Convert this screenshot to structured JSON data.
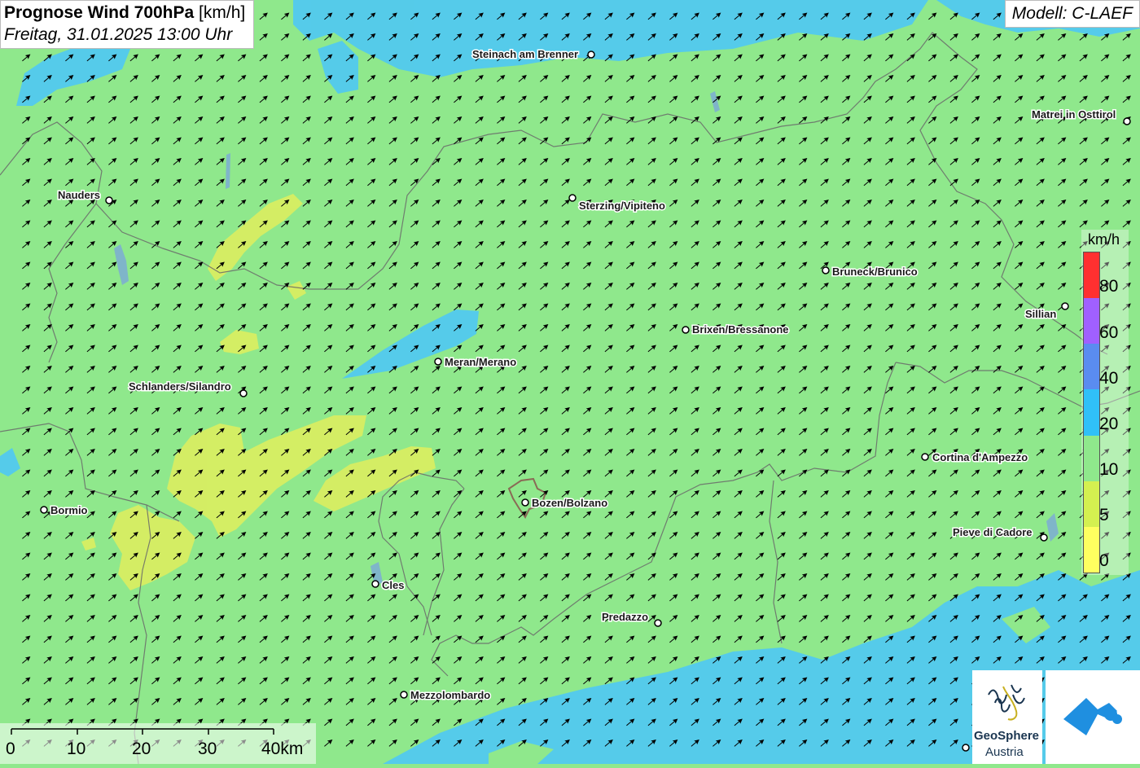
{
  "title": {
    "main": "Prognose Wind 700hPa",
    "unit": "[km/h]",
    "datetime": "Freitag, 31.01.2025 13:00 Uhr"
  },
  "model": "Modell: C-LAEF",
  "legend": {
    "unit": "km/h",
    "labels": [
      "80",
      "60",
      "40",
      "20",
      "10",
      "5",
      "0"
    ],
    "colors": [
      "#ff3030",
      "#a060ff",
      "#5a8cf0",
      "#30c0f8",
      "#8fe88c",
      "#d4f050",
      "#ffff60"
    ]
  },
  "scale_bar": {
    "labels": [
      "0",
      "10",
      "20",
      "30",
      "40km"
    ]
  },
  "cities": [
    {
      "name": "Steinach am Brenner"
    },
    {
      "name": "Matrei in Osttirol"
    },
    {
      "name": "Nauders"
    },
    {
      "name": "Sterzing/Vipiteno"
    },
    {
      "name": "Bruneck/Brunico"
    },
    {
      "name": "Sillian"
    },
    {
      "name": "Brixen/Bressanone"
    },
    {
      "name": "Meran/Merano"
    },
    {
      "name": "Schlanders/Silandro"
    },
    {
      "name": "Cortina d'Ampezzo"
    },
    {
      "name": "Bozen/Bolzano"
    },
    {
      "name": "Bormio"
    },
    {
      "name": "Pieve di Cadore"
    },
    {
      "name": "Cles"
    },
    {
      "name": "Predazzo"
    },
    {
      "name": "Mezzolombardo"
    }
  ],
  "logos": {
    "geosphere_line1": "GeoSphere",
    "geosphere_line2": "Austria"
  },
  "colors": {
    "base": "#8fe88c",
    "low": "#d4f050",
    "high": "#30c0f8",
    "border": "#6a6a6a"
  }
}
